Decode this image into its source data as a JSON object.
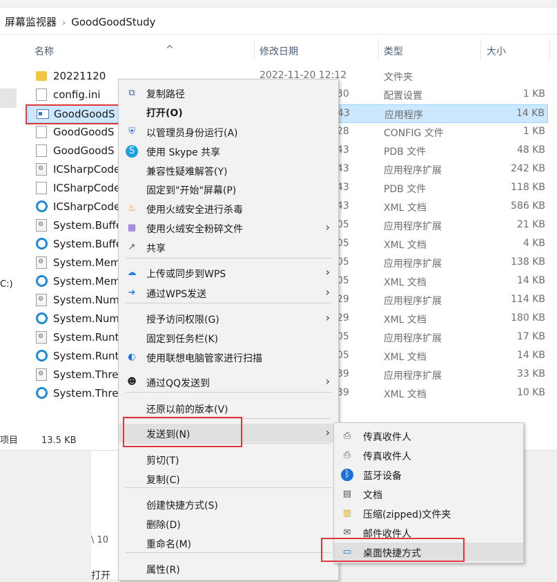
{
  "breadcrumb": {
    "root": "屏幕监视器",
    "current": "GoodGoodStudy"
  },
  "columns": {
    "name": "名称",
    "modified": "修改日期",
    "type": "类型",
    "size": "大小"
  },
  "files": [
    {
      "name": "20221120",
      "date": "2022-11-20 12:12",
      "type": "文件夹",
      "size": "",
      "icon": "folder-icon"
    },
    {
      "name": "config.ini",
      "date": "30",
      "type": "配置设置",
      "size": "1 KB",
      "icon": "settings-file-icon"
    },
    {
      "name": "GoodGoodS",
      "date": "43",
      "type": "应用程序",
      "size": "14 KB",
      "icon": "application-icon"
    },
    {
      "name": "GoodGoodS",
      "date": "28",
      "type": "CONFIG 文件",
      "size": "1 KB",
      "icon": "file-icon"
    },
    {
      "name": "GoodGoodS",
      "date": "43",
      "type": "PDB 文件",
      "size": "48 KB",
      "icon": "file-icon"
    },
    {
      "name": "ICSharpCode",
      "date": "43",
      "type": "应用程序扩展",
      "size": "242 KB",
      "icon": "dll-icon"
    },
    {
      "name": "ICSharpCode",
      "date": "43",
      "type": "PDB 文件",
      "size": "118 KB",
      "icon": "file-icon"
    },
    {
      "name": "ICSharpCode",
      "date": "43",
      "type": "XML 文档",
      "size": "586 KB",
      "icon": "ie-xml-icon"
    },
    {
      "name": "System.Buffe",
      "date": "05",
      "type": "应用程序扩展",
      "size": "21 KB",
      "icon": "dll-icon"
    },
    {
      "name": "System.Buffe",
      "date": "05",
      "type": "XML 文档",
      "size": "4 KB",
      "icon": "ie-xml-icon"
    },
    {
      "name": "System.Mem",
      "date": "05",
      "type": "应用程序扩展",
      "size": "138 KB",
      "icon": "dll-icon"
    },
    {
      "name": "System.Mem",
      "date": "05",
      "type": "XML 文档",
      "size": "14 KB",
      "icon": "ie-xml-icon"
    },
    {
      "name": "System.Num",
      "date": "29",
      "type": "应用程序扩展",
      "size": "114 KB",
      "icon": "dll-icon"
    },
    {
      "name": "System.Num",
      "date": "29",
      "type": "XML 文档",
      "size": "180 KB",
      "icon": "ie-xml-icon"
    },
    {
      "name": "System.Runt",
      "date": "05",
      "type": "应用程序扩展",
      "size": "17 KB",
      "icon": "dll-icon"
    },
    {
      "name": "System.Runt",
      "date": "05",
      "type": "XML 文档",
      "size": "14 KB",
      "icon": "ie-xml-icon"
    },
    {
      "name": "System.Threa",
      "date": "39",
      "type": "应用程序扩展",
      "size": "33 KB",
      "icon": "dll-icon"
    },
    {
      "name": "System.Threa",
      "date": "39",
      "type": "XML 文档",
      "size": "10 KB",
      "icon": "ie-xml-icon"
    }
  ],
  "nav": {
    "drive_fragment": "C:)"
  },
  "status": {
    "items_fragment": "项目",
    "selection_size": "13.5 KB"
  },
  "context_menu": [
    {
      "label": "复制路径",
      "icon": "copy-path-icon"
    },
    {
      "label": "打开(O)",
      "icon": ""
    },
    {
      "label": "以管理员身份运行(A)",
      "icon": "uac-shield-icon"
    },
    {
      "label": "使用 Skype 共享",
      "icon": "skype-icon"
    },
    {
      "label": "兼容性疑难解答(Y)",
      "icon": ""
    },
    {
      "label": "固定到\"开始\"屏幕(P)",
      "icon": ""
    },
    {
      "label": "使用火绒安全进行杀毒",
      "icon": "huorong-icon"
    },
    {
      "label": "使用火绒安全粉碎文件",
      "icon": "shredder-icon"
    },
    {
      "label": "共享",
      "icon": "share-icon"
    },
    {
      "label": "上传或同步到WPS",
      "icon": "wps-upload-icon"
    },
    {
      "label": "通过WPS发送",
      "icon": "wps-send-icon"
    },
    {
      "label": "授予访问权限(G)",
      "icon": ""
    },
    {
      "label": "固定到任务栏(K)",
      "icon": ""
    },
    {
      "label": "使用联想电脑管家进行扫描",
      "icon": "lenovo-icon"
    },
    {
      "label": "通过QQ发送到",
      "icon": "qq-icon"
    },
    {
      "label": "还原以前的版本(V)",
      "icon": ""
    },
    {
      "label": "发送到(N)",
      "icon": ""
    },
    {
      "label": "剪切(T)",
      "icon": ""
    },
    {
      "label": "复制(C)",
      "icon": ""
    },
    {
      "label": "创建快捷方式(S)",
      "icon": ""
    },
    {
      "label": "删除(D)",
      "icon": ""
    },
    {
      "label": "重命名(M)",
      "icon": ""
    },
    {
      "label": "属性(R)",
      "icon": ""
    }
  ],
  "send_to_menu": [
    {
      "label": "传真收件人",
      "icon": "fax-icon"
    },
    {
      "label": "传真收件人",
      "icon": "fax-icon"
    },
    {
      "label": "蓝牙设备",
      "icon": "bluetooth-icon"
    },
    {
      "label": "文档",
      "icon": "documents-icon"
    },
    {
      "label": "压缩(zipped)文件夹",
      "icon": "zip-folder-icon"
    },
    {
      "label": "邮件收件人",
      "icon": "mail-icon"
    },
    {
      "label": "桌面快捷方式",
      "icon": "desktop-icon"
    }
  ],
  "background_text": {
    "line1": "\\ 10",
    "line2": "打开"
  },
  "colors": {
    "selection_bg": "#cce8ff",
    "highlight_box": "#e0373b",
    "header_text": "#4c607a"
  }
}
